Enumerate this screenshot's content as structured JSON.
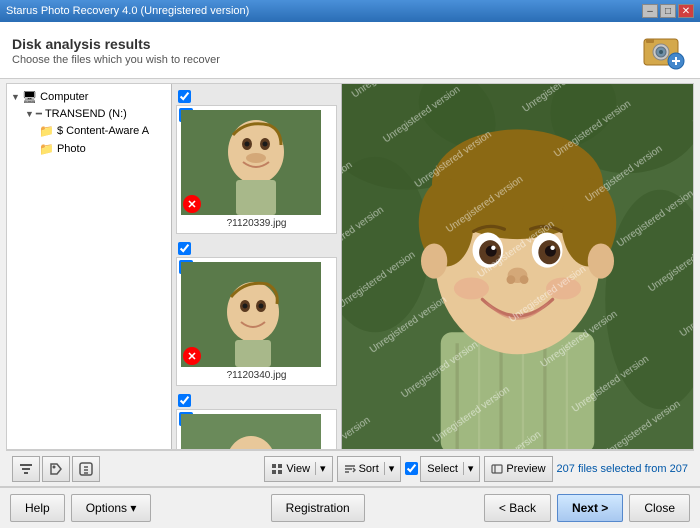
{
  "window": {
    "title": "Starus Photo Recovery 4.0 (Unregistered version)",
    "min_btn": "–",
    "max_btn": "□",
    "close_btn": "✕"
  },
  "header": {
    "title": "Disk analysis results",
    "subtitle": "Choose the files which you wish to recover"
  },
  "tree": {
    "items": [
      {
        "label": "Computer",
        "level": 0,
        "type": "computer"
      },
      {
        "label": "TRANSEND (N:)",
        "level": 1,
        "type": "drive"
      },
      {
        "label": "$ Content-Aware A",
        "level": 2,
        "type": "folder"
      },
      {
        "label": "Photo",
        "level": 2,
        "type": "folder"
      }
    ]
  },
  "thumbnails": [
    {
      "filename": "?1120339.jpg",
      "checked": true
    },
    {
      "filename": "?1120340.jpg",
      "checked": true
    }
  ],
  "toolbar": {
    "view_label": "View",
    "sort_label": "Sort",
    "select_label": "Select",
    "preview_label": "Preview",
    "file_count": "207 files selected from 207"
  },
  "bottom_bar": {
    "help_label": "Help",
    "options_label": "Options",
    "registration_label": "Registration",
    "back_label": "< Back",
    "next_label": "Next >",
    "close_label": "Close"
  }
}
